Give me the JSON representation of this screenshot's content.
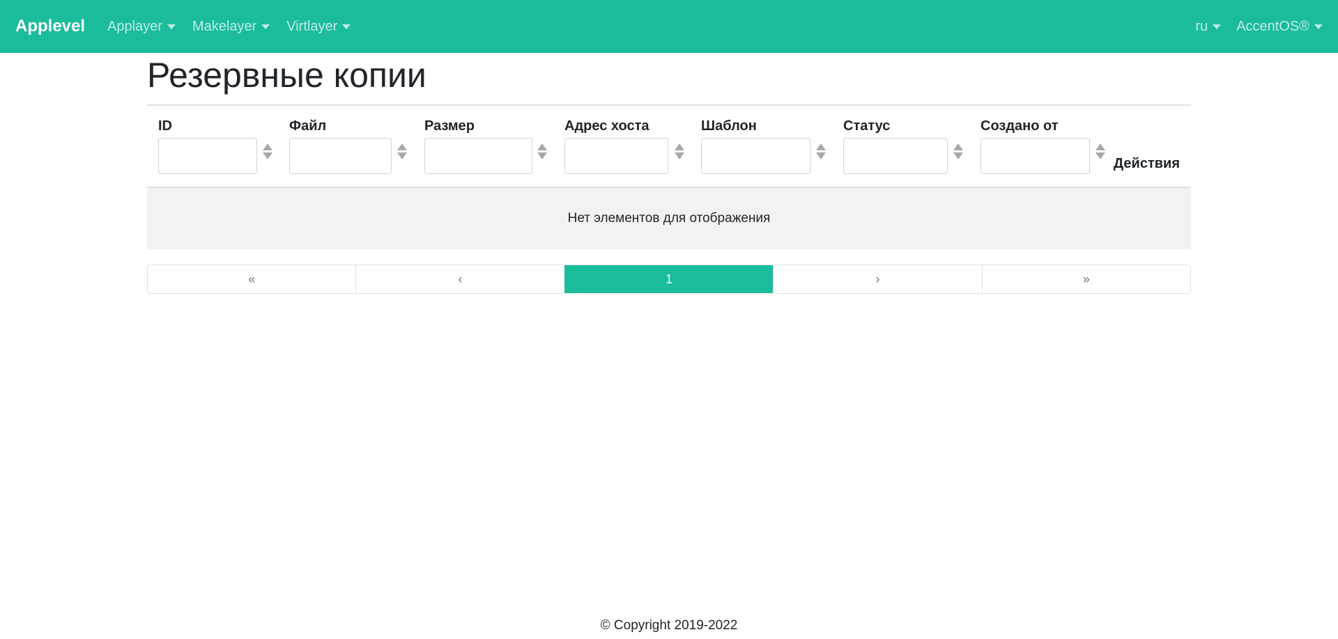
{
  "navbar": {
    "brand": "Applevel",
    "menus": [
      "Applayer",
      "Makelayer",
      "Virtlayer"
    ],
    "language": "ru",
    "user": "AccentOS®",
    "accent_color": "#1abc9c"
  },
  "page": {
    "title": "Резервные копии"
  },
  "table": {
    "columns": [
      "ID",
      "Файл",
      "Размер",
      "Адрес хоста",
      "Шаблон",
      "Статус",
      "Создано от"
    ],
    "actions_label": "Действия",
    "empty_message": "Нет элементов для отображения"
  },
  "pagination": {
    "first": "«",
    "prev": "‹",
    "current": "1",
    "next": "›",
    "last": "»"
  },
  "footer": {
    "copyright": "© Copyright 2019-2022"
  },
  "icons": [
    "caret-down-icon",
    "sort-icon"
  ]
}
